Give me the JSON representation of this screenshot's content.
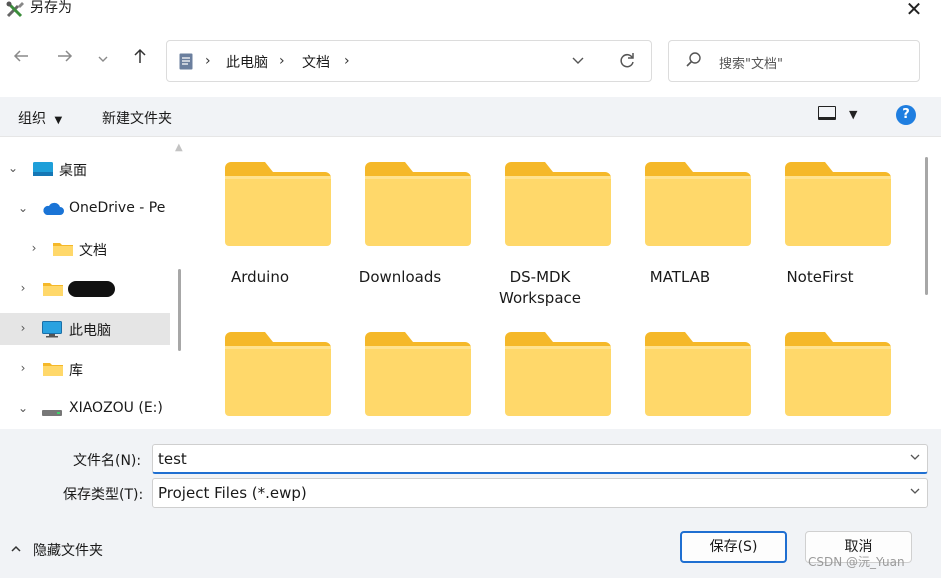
{
  "window": {
    "title": "另存为",
    "close_glyph": "✕"
  },
  "nav": {
    "back_icon": "arrow-left-icon",
    "forward_icon": "arrow-right-icon",
    "recent_icon": "chevron-down-icon",
    "up_icon": "arrow-up-icon"
  },
  "address": {
    "crumbs": [
      "此电脑",
      "文档"
    ],
    "separator": "›"
  },
  "search": {
    "placeholder": "搜索\"文档\""
  },
  "toolbar": {
    "organize_label": "组织",
    "new_folder_label": "新建文件夹",
    "help_label": "?"
  },
  "tree": {
    "items": [
      {
        "label": "桌面",
        "icon": "desktop-icon"
      },
      {
        "label": "OneDrive - Pe",
        "icon": "cloud-icon"
      },
      {
        "label": "文档",
        "icon": "folder-icon"
      },
      {
        "label": "",
        "icon": "folder-icon"
      },
      {
        "label": "此电脑",
        "icon": "monitor-icon"
      },
      {
        "label": "库",
        "icon": "folder-icon"
      },
      {
        "label": "XIAOZOU (E:)",
        "icon": "drive-icon"
      }
    ]
  },
  "folders": [
    {
      "name": "Arduino"
    },
    {
      "name": "Downloads"
    },
    {
      "name": "DS-MDK\nWorkspace"
    },
    {
      "name": "MATLAB"
    },
    {
      "name": "NoteFirst"
    },
    {
      "name": ""
    },
    {
      "name": ""
    },
    {
      "name": ""
    },
    {
      "name": ""
    },
    {
      "name": ""
    }
  ],
  "form": {
    "filename_label": "文件名(N):",
    "filename_value": "test",
    "filetype_label": "保存类型(T):",
    "filetype_value": "Project Files (*.ewp)"
  },
  "footer": {
    "hide_folders_label": "隐藏文件夹",
    "save_label": "保存(S)",
    "cancel_label": "取消",
    "watermark": "CSDN @沅_Yuan"
  },
  "colors": {
    "folder_body": "#FFD86A",
    "folder_tab": "#F5B829",
    "accent": "#1F6FD1",
    "toolbar_bg": "#F1F3F6"
  }
}
